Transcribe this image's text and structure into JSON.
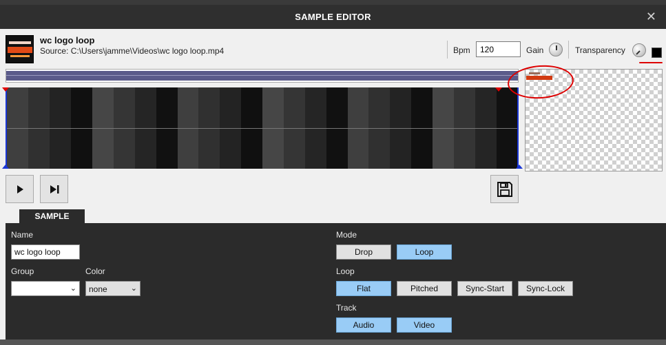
{
  "window": {
    "title": "SAMPLE EDITOR",
    "close_glyph": "✕"
  },
  "clip": {
    "name": "wc logo loop",
    "source": "Source: C:\\Users\\jamme\\Videos\\wc logo loop.mp4"
  },
  "header": {
    "bpm_label": "Bpm",
    "bpm_value": "120",
    "gain_label": "Gain",
    "transparency_label": "Transparency",
    "color_swatch": "#000000"
  },
  "timeline": {
    "colors": [
      "#3f3f3f",
      "#303030",
      "#232323",
      "#101010",
      "#464646",
      "#353535",
      "#252525",
      "#111111",
      "#3f3f3f",
      "#303030",
      "#232323",
      "#101010",
      "#464646",
      "#353535",
      "#252525",
      "#111111",
      "#3f3f3f",
      "#303030",
      "#232323",
      "#101010",
      "#464646",
      "#353535",
      "#252525",
      "#111111"
    ],
    "marker_color": "#e00000",
    "bound_color": "#1a36d6"
  },
  "transport": {
    "play_icon": "play-icon",
    "skip_icon": "skip-to-end-icon",
    "save_icon": "floppy-disk-icon"
  },
  "sample": {
    "tab_label": "SAMPLE",
    "name_label": "Name",
    "name_value": "wc logo loop",
    "group_label": "Group",
    "group_value": "",
    "color_label": "Color",
    "color_value": "none",
    "mode_label": "Mode",
    "mode_buttons": [
      {
        "label": "Drop",
        "active": false
      },
      {
        "label": "Loop",
        "active": true
      }
    ],
    "loop_label": "Loop",
    "loop_buttons": [
      {
        "label": "Flat",
        "active": true
      },
      {
        "label": "Pitched",
        "active": false
      },
      {
        "label": "Sync-Start",
        "active": false
      },
      {
        "label": "Sync-Lock",
        "active": false
      }
    ],
    "track_label": "Track",
    "track_buttons": [
      {
        "label": "Audio",
        "active": true
      },
      {
        "label": "Video",
        "active": true
      }
    ]
  },
  "theme": {
    "active_button": "#99ccf6",
    "annotation_red": "#dd0000"
  }
}
